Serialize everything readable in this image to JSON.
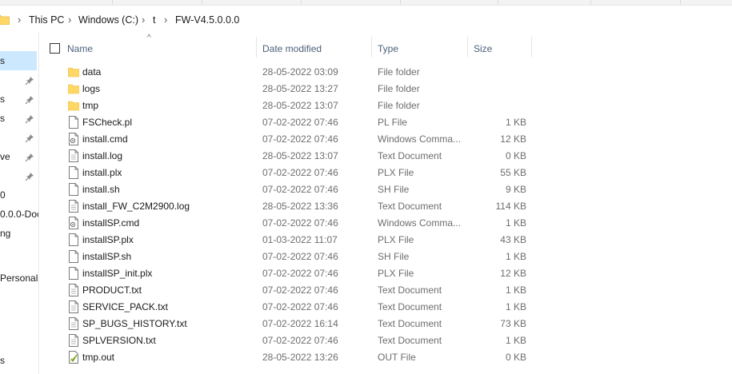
{
  "breadcrumb": [
    "This PC",
    "Windows (C:)",
    "t",
    "FW-V4.5.0.0.0"
  ],
  "breadcrumb_separator": "›",
  "sidebar": {
    "items": [
      {
        "label": "s",
        "selected": true,
        "pinned": false
      },
      {
        "label": "",
        "selected": false,
        "pinned": true
      },
      {
        "label": "s",
        "selected": false,
        "pinned": true
      },
      {
        "label": "s",
        "selected": false,
        "pinned": true
      },
      {
        "label": "",
        "selected": false,
        "pinned": true
      },
      {
        "label": "ve",
        "selected": false,
        "pinned": true
      },
      {
        "label": "",
        "selected": false,
        "pinned": true
      },
      {
        "label": "0",
        "selected": false,
        "pinned": false
      },
      {
        "label": "0.0.0-Doc",
        "selected": false,
        "pinned": false
      },
      {
        "label": "ng",
        "selected": false,
        "pinned": false
      },
      {
        "label": "Personal",
        "selected": false,
        "pinned": false
      },
      {
        "label": "s",
        "selected": false,
        "pinned": false
      }
    ]
  },
  "columns": {
    "name": "Name",
    "date": "Date modified",
    "type": "Type",
    "size": "Size"
  },
  "sort_indicator": "^",
  "files": [
    {
      "name": "data",
      "date": "28-05-2022 03:09",
      "type": "File folder",
      "size": "",
      "icon": "folder-icon"
    },
    {
      "name": "logs",
      "date": "28-05-2022 13:27",
      "type": "File folder",
      "size": "",
      "icon": "folder-icon"
    },
    {
      "name": "tmp",
      "date": "28-05-2022 13:07",
      "type": "File folder",
      "size": "",
      "icon": "folder-icon"
    },
    {
      "name": "FSCheck.pl",
      "date": "07-02-2022 07:46",
      "type": "PL File",
      "size": "1 KB",
      "icon": "file-icon"
    },
    {
      "name": "install.cmd",
      "date": "07-02-2022 07:46",
      "type": "Windows Comma...",
      "size": "12 KB",
      "icon": "cmd-file-icon"
    },
    {
      "name": "install.log",
      "date": "28-05-2022 13:07",
      "type": "Text Document",
      "size": "0 KB",
      "icon": "text-file-icon"
    },
    {
      "name": "install.plx",
      "date": "07-02-2022 07:46",
      "type": "PLX File",
      "size": "55 KB",
      "icon": "file-icon"
    },
    {
      "name": "install.sh",
      "date": "07-02-2022 07:46",
      "type": "SH File",
      "size": "9 KB",
      "icon": "file-icon"
    },
    {
      "name": "install_FW_C2M2900.log",
      "date": "28-05-2022 13:36",
      "type": "Text Document",
      "size": "114 KB",
      "icon": "text-file-icon"
    },
    {
      "name": "installSP.cmd",
      "date": "07-02-2022 07:46",
      "type": "Windows Comma...",
      "size": "1 KB",
      "icon": "cmd-file-icon"
    },
    {
      "name": "installSP.plx",
      "date": "01-03-2022 11:07",
      "type": "PLX File",
      "size": "43 KB",
      "icon": "file-icon"
    },
    {
      "name": "installSP.sh",
      "date": "07-02-2022 07:46",
      "type": "SH File",
      "size": "1 KB",
      "icon": "file-icon"
    },
    {
      "name": "installSP_init.plx",
      "date": "07-02-2022 07:46",
      "type": "PLX File",
      "size": "12 KB",
      "icon": "file-icon"
    },
    {
      "name": "PRODUCT.txt",
      "date": "07-02-2022 07:46",
      "type": "Text Document",
      "size": "1 KB",
      "icon": "text-file-icon"
    },
    {
      "name": "SERVICE_PACK.txt",
      "date": "07-02-2022 07:46",
      "type": "Text Document",
      "size": "1 KB",
      "icon": "text-file-icon"
    },
    {
      "name": "SP_BUGS_HISTORY.txt",
      "date": "07-02-2022 16:14",
      "type": "Text Document",
      "size": "73 KB",
      "icon": "text-file-icon"
    },
    {
      "name": "SPLVERSION.txt",
      "date": "07-02-2022 07:46",
      "type": "Text Document",
      "size": "1 KB",
      "icon": "text-file-icon"
    },
    {
      "name": "tmp.out",
      "date": "28-05-2022 13:26",
      "type": "OUT File",
      "size": "0 KB",
      "icon": "out-file-icon"
    }
  ],
  "colors": {
    "selection": "#cce8ff",
    "folder": "#ffd767",
    "header_text": "#4c607a",
    "secondary_text": "#6d6d6d"
  }
}
